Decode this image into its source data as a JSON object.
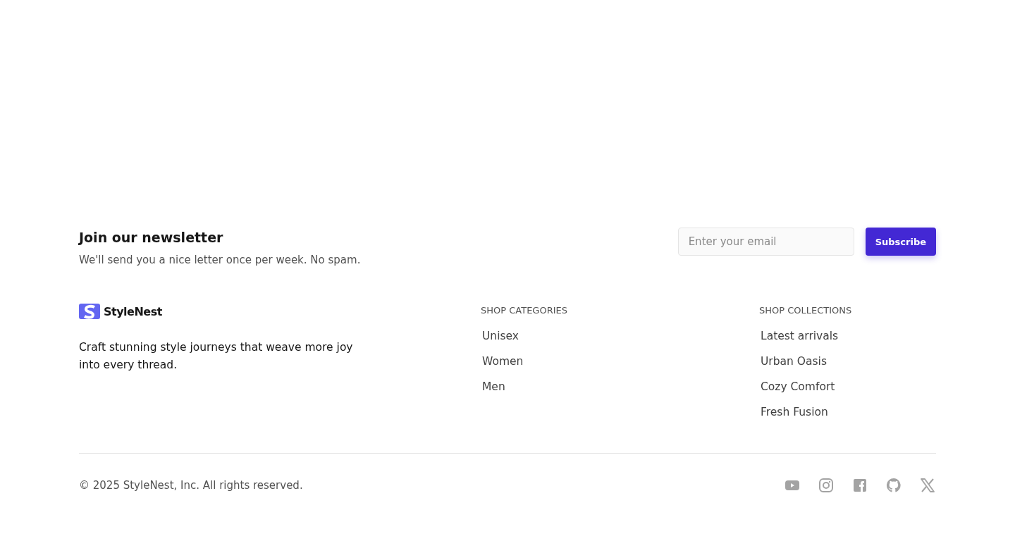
{
  "newsletter": {
    "title": "Join our newsletter",
    "subtitle": "We'll send you a nice letter once per week. No spam.",
    "email_field": {
      "placeholder": "Enter your email"
    },
    "button": "Subscribe"
  },
  "brand": {
    "name": "StyleNest",
    "tagline": "Craft stunning style journeys that weave more joy into every thread."
  },
  "columns": [
    {
      "heading": "SHOP CATEGORIES",
      "links": [
        "Unisex",
        "Women",
        "Men"
      ]
    },
    {
      "heading": "SHOP COLLECTIONS",
      "links": [
        "Latest arrivals",
        "Urban Oasis",
        "Cozy Comfort",
        "Fresh Fusion"
      ]
    }
  ],
  "copyright": "© 2025 StyleNest, Inc. All rights reserved.",
  "social": [
    {
      "kind": "video"
    },
    {
      "kind": "camera"
    },
    {
      "kind": "f"
    },
    {
      "kind": "cat"
    },
    {
      "kind": "x"
    }
  ]
}
